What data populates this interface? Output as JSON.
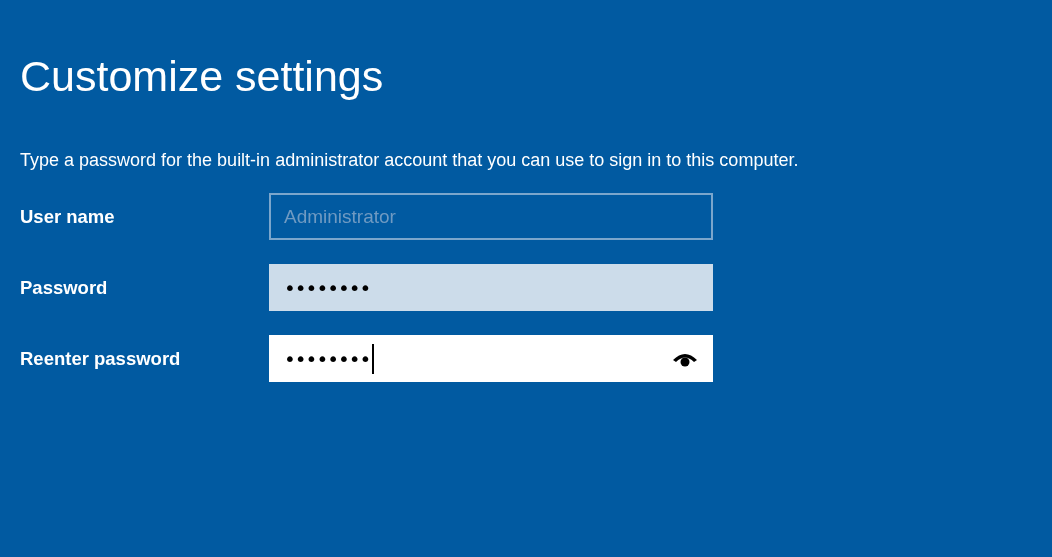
{
  "title": "Customize settings",
  "instruction": "Type a password for the built-in administrator account that you can use to sign in to this computer.",
  "fields": [
    {
      "label": "User name",
      "value": "Administrator",
      "disabled": true,
      "focused": false,
      "reveal": false
    },
    {
      "label": "Password",
      "value": "••••••••",
      "disabled": false,
      "focused": false,
      "reveal": false
    },
    {
      "label": "Reenter password",
      "value": "••••••••",
      "disabled": false,
      "focused": true,
      "reveal": true
    }
  ]
}
